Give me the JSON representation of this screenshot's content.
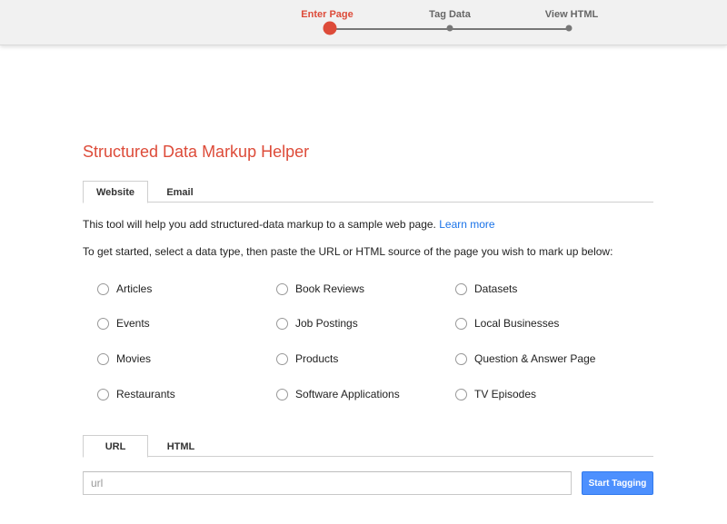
{
  "progress": {
    "steps": [
      {
        "label": "Enter Page",
        "active": true
      },
      {
        "label": "Tag Data",
        "active": false
      },
      {
        "label": "View HTML",
        "active": false
      }
    ],
    "active_color": "#dd4b39",
    "inactive_color": "#777777"
  },
  "page_title": "Structured Data Markup Helper",
  "source_tabs": [
    {
      "label": "Website",
      "active": true
    },
    {
      "label": "Email",
      "active": false
    }
  ],
  "intro": {
    "text": "This tool will help you add structured-data markup to a sample web page. ",
    "link_label": "Learn more"
  },
  "instructions": "To get started, select a data type, then paste the URL or HTML source of the page you wish to mark up below:",
  "data_types": [
    [
      "Articles",
      "Book Reviews",
      "Datasets"
    ],
    [
      "Events",
      "Job Postings",
      "Local Businesses"
    ],
    [
      "Movies",
      "Products",
      "Question & Answer Page"
    ],
    [
      "Restaurants",
      "Software Applications",
      "TV Episodes"
    ]
  ],
  "input_tabs": [
    {
      "label": "URL",
      "active": true
    },
    {
      "label": "HTML",
      "active": false
    }
  ],
  "url_input": {
    "placeholder": "url",
    "value": ""
  },
  "start_button_label": "Start Tagging",
  "colors": {
    "accent": "#dd4b39",
    "link": "#1a73e8",
    "button": "#4d90fe"
  }
}
